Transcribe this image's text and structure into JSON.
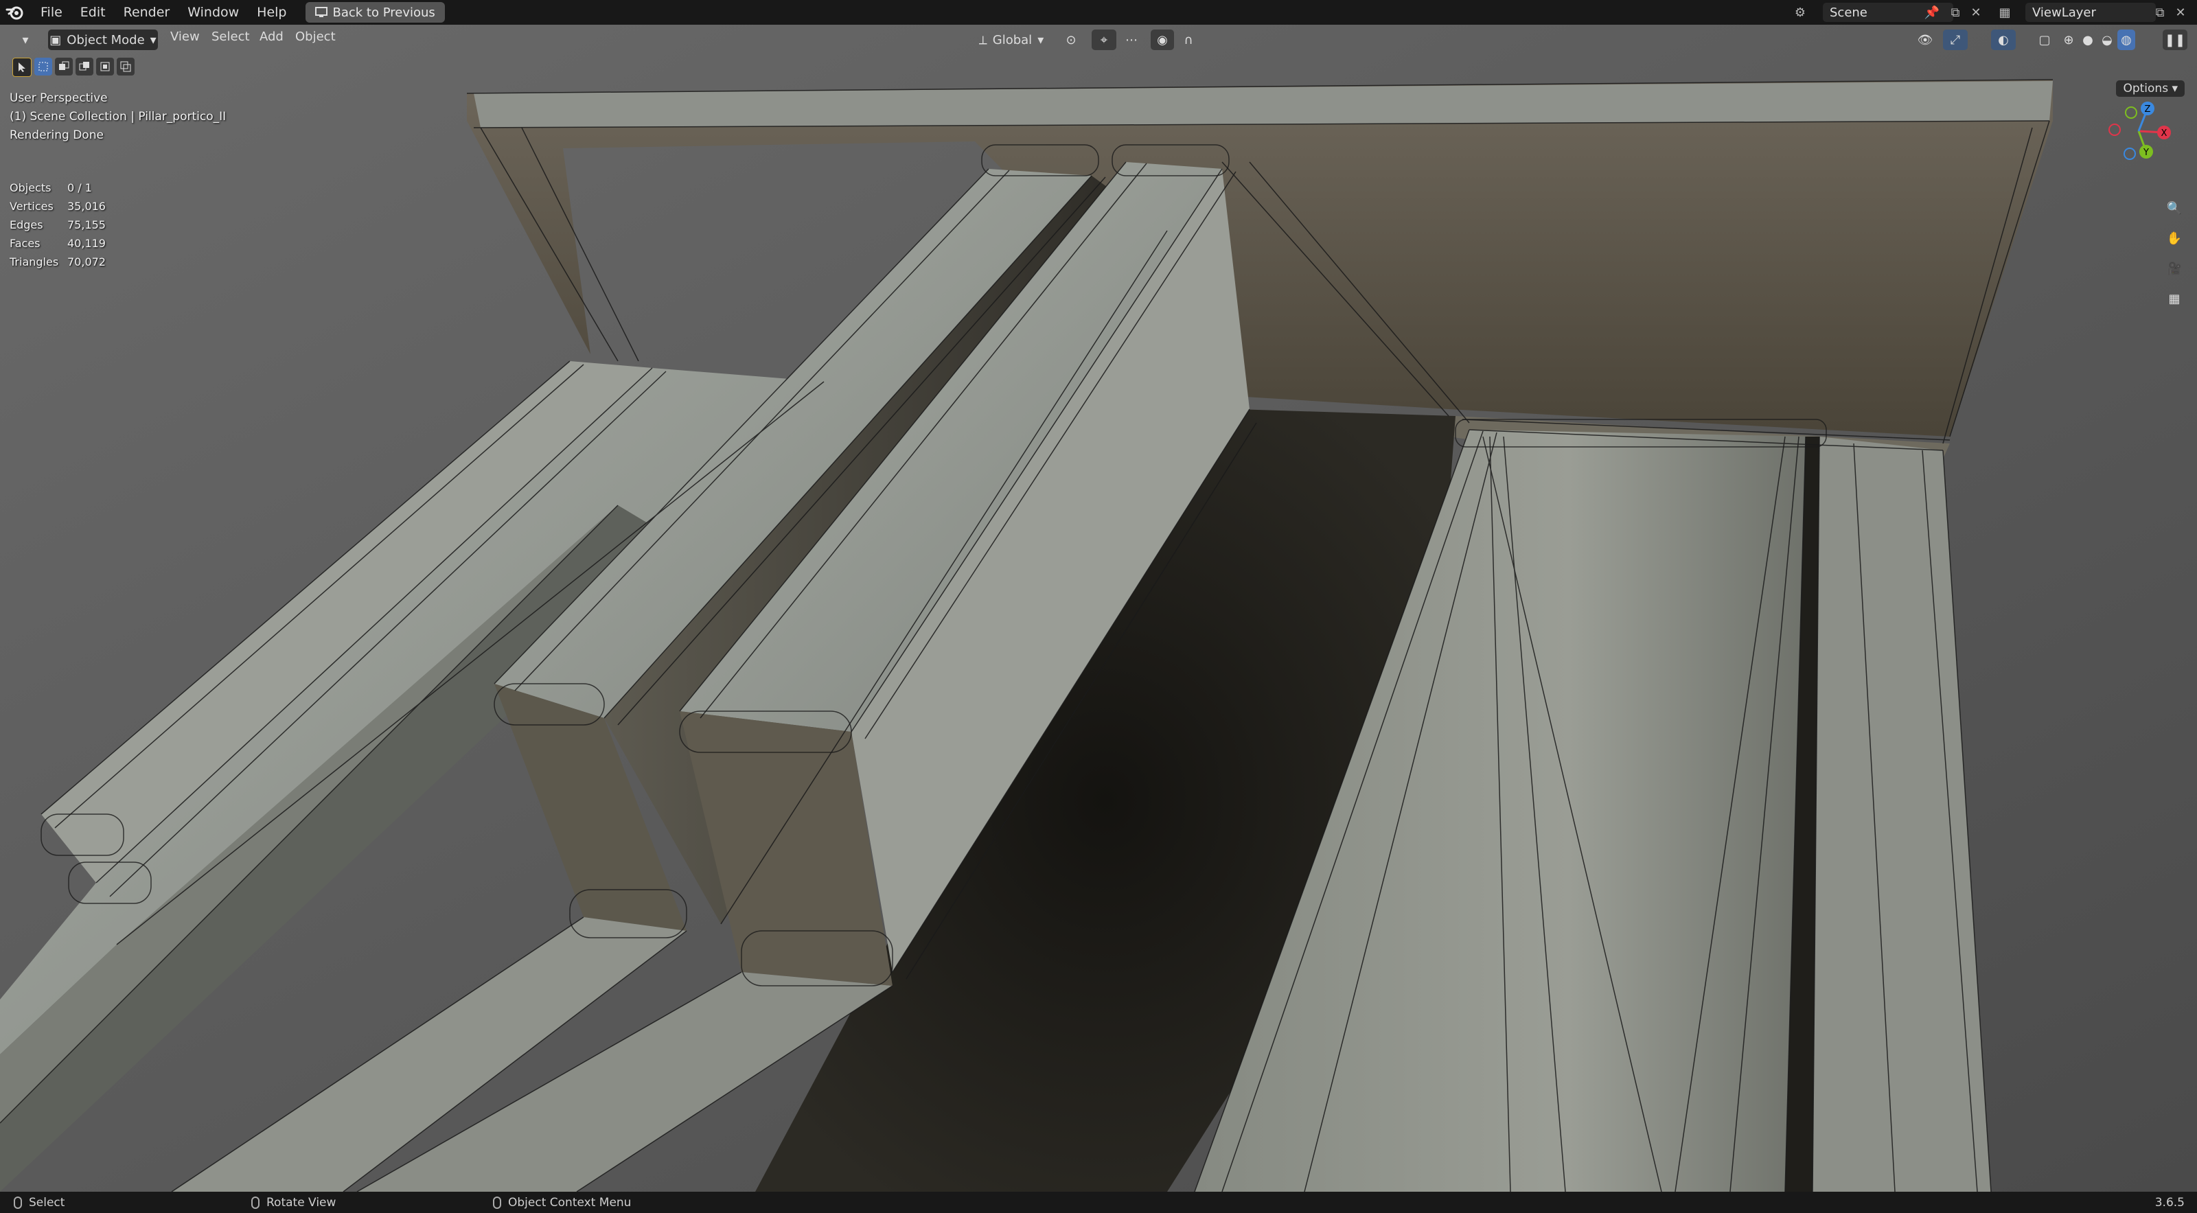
{
  "menu": {
    "items": [
      "File",
      "Edit",
      "Render",
      "Window",
      "Help"
    ],
    "back_label": "Back to Previous"
  },
  "header_right": {
    "scene": "Scene",
    "view_layer": "ViewLayer"
  },
  "viewport_header": {
    "mode": "Object Mode",
    "menus": [
      "View",
      "Select",
      "Add",
      "Object"
    ],
    "orientation": "Global",
    "options_label": "Options"
  },
  "overlay": {
    "perspective": "User Perspective",
    "collection": "(1) Scene Collection | Pillar_portico_II",
    "status": "Rendering Done"
  },
  "stats": [
    {
      "label": "Objects",
      "value": "0 / 1"
    },
    {
      "label": "Vertices",
      "value": "35,016"
    },
    {
      "label": "Edges",
      "value": "75,155"
    },
    {
      "label": "Faces",
      "value": "40,119"
    },
    {
      "label": "Triangles",
      "value": "70,072"
    }
  ],
  "gizmo": {
    "x": "X",
    "y": "Y",
    "z": "Z"
  },
  "statusbar": {
    "select": "Select",
    "rotate": "Rotate View",
    "context": "Object Context Menu",
    "version": "3.6.5"
  },
  "colors": {
    "accent": "#4772b3",
    "axis_x": "#e0354a",
    "axis_y": "#7dbe20",
    "axis_z": "#3a89e0"
  }
}
